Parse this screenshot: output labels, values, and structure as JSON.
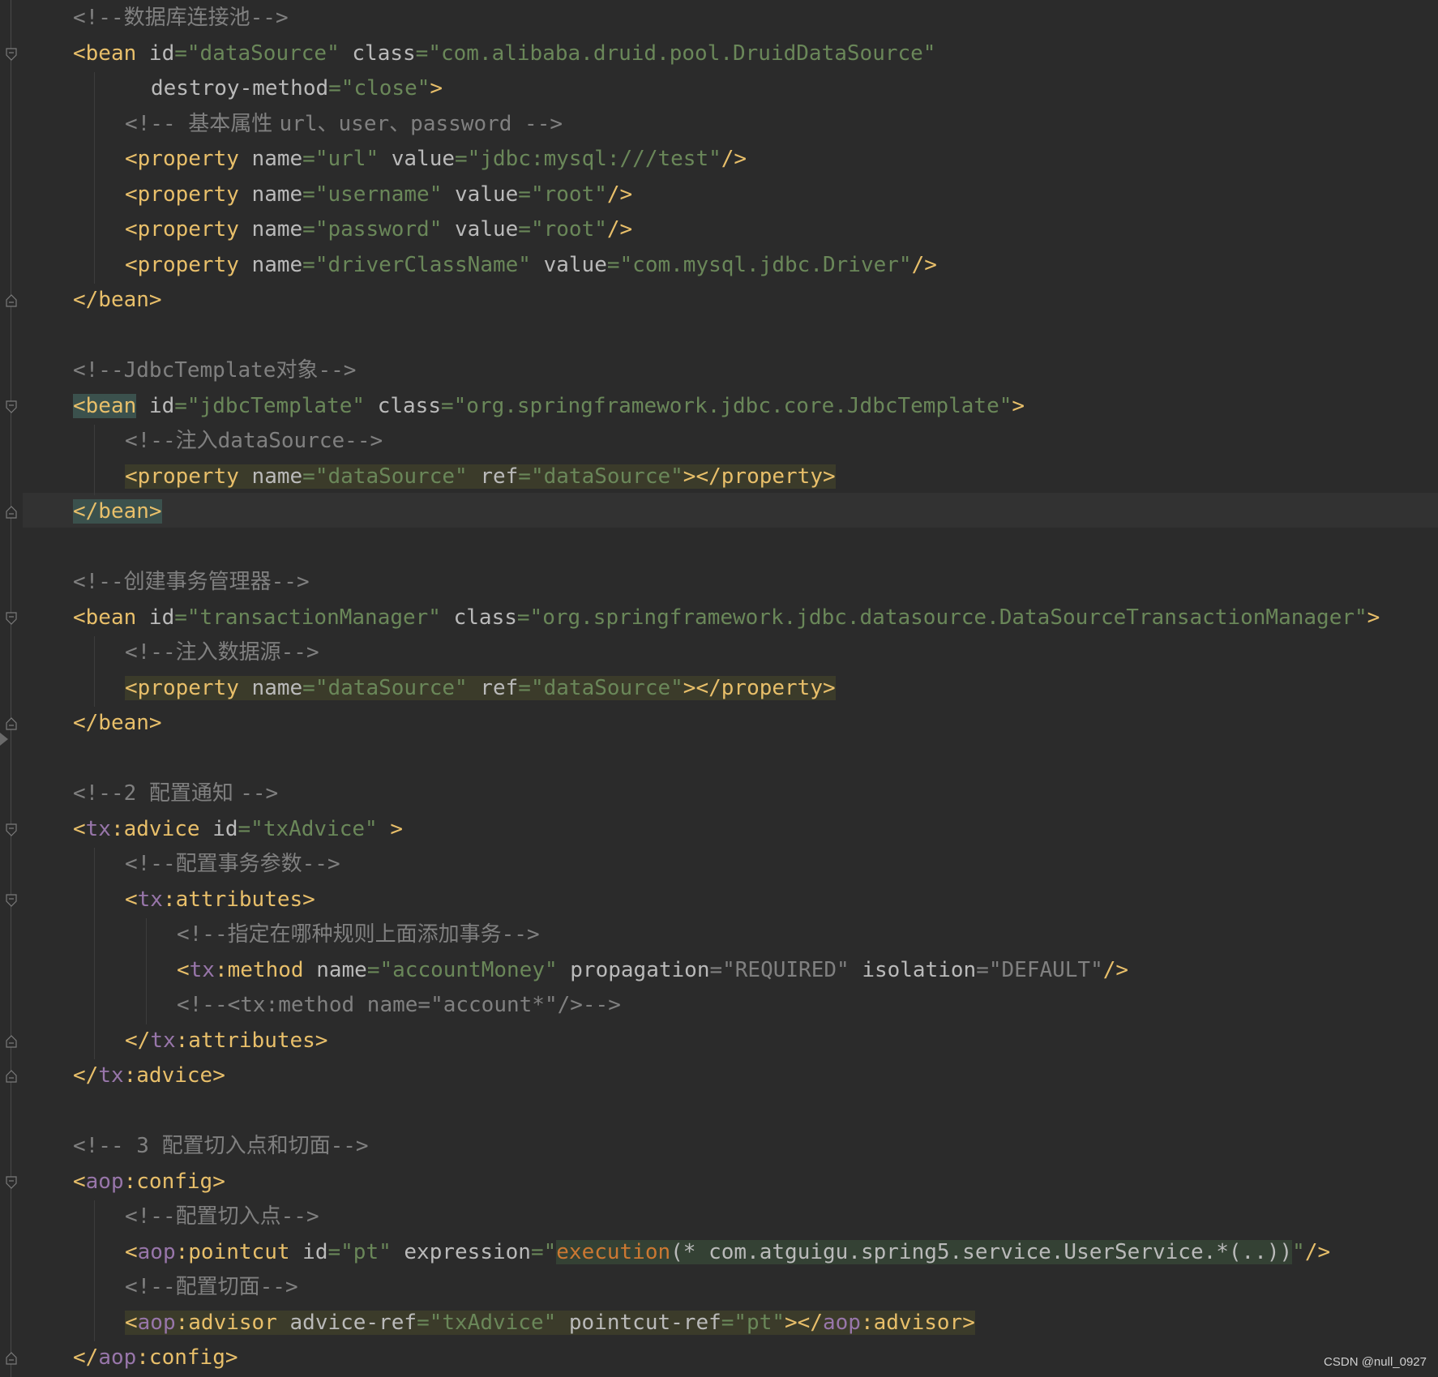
{
  "editor": {
    "lines": [
      {
        "t": 0,
        "indent": 0,
        "tokens": [
          [
            "cm",
            "<!--"
          ],
          [
            "cmc",
            "数据库连接池"
          ],
          [
            "cm",
            "-->"
          ]
        ]
      },
      {
        "t": 1,
        "indent": 0,
        "tokens": [
          [
            "tg",
            "<bean "
          ],
          [
            "at",
            "id"
          ],
          [
            "vl",
            "=\"dataSource\" "
          ],
          [
            "at",
            "class"
          ],
          [
            "vl",
            "=\"com.alibaba.druid.pool.DruidDataSource\""
          ]
        ]
      },
      {
        "t": 2,
        "indent": 3,
        "tokens": [
          [
            "at",
            "destroy-method"
          ],
          [
            "vl",
            "=\"close\""
          ],
          [
            "tg",
            ">"
          ]
        ]
      },
      {
        "t": 3,
        "indent": 2,
        "tokens": [
          [
            "cm",
            "<!-- "
          ],
          [
            "cmc",
            "基本属性 "
          ],
          [
            "cm",
            "url"
          ],
          [
            "cmc",
            "、"
          ],
          [
            "cm",
            "user"
          ],
          [
            "cmc",
            "、"
          ],
          [
            "cm",
            "password -->"
          ]
        ]
      },
      {
        "t": 4,
        "indent": 2,
        "tokens": [
          [
            "tg",
            "<property "
          ],
          [
            "at",
            "name"
          ],
          [
            "vl",
            "=\"url\" "
          ],
          [
            "at",
            "value"
          ],
          [
            "vl",
            "=\"jdbc:mysql:///test\""
          ],
          [
            "tg",
            "/>"
          ]
        ]
      },
      {
        "t": 5,
        "indent": 2,
        "tokens": [
          [
            "tg",
            "<property "
          ],
          [
            "at",
            "name"
          ],
          [
            "vl",
            "=\"username\" "
          ],
          [
            "at",
            "value"
          ],
          [
            "vl",
            "=\"root\""
          ],
          [
            "tg",
            "/>"
          ]
        ]
      },
      {
        "t": 6,
        "indent": 2,
        "tokens": [
          [
            "tg",
            "<property "
          ],
          [
            "at",
            "name"
          ],
          [
            "vl",
            "=\"password\" "
          ],
          [
            "at",
            "value"
          ],
          [
            "vl",
            "=\"root\""
          ],
          [
            "tg",
            "/>"
          ]
        ]
      },
      {
        "t": 7,
        "indent": 2,
        "tokens": [
          [
            "tg",
            "<property "
          ],
          [
            "at",
            "name"
          ],
          [
            "vl",
            "=\"driverClassName\" "
          ],
          [
            "at",
            "value"
          ],
          [
            "vl",
            "=\"com.mysql.jdbc.Driver\""
          ],
          [
            "tg",
            "/>"
          ]
        ]
      },
      {
        "t": 8,
        "indent": 0,
        "tokens": [
          [
            "tg",
            "</bean>"
          ]
        ]
      },
      {
        "t": 10,
        "indent": 0,
        "tokens": [
          [
            "cm",
            "<!--JdbcTemplate"
          ],
          [
            "cmc",
            "对象"
          ],
          [
            "cm",
            "-->"
          ]
        ]
      },
      {
        "t": 11,
        "indent": 0,
        "tokens": [
          [
            "tg hlb",
            "<bean"
          ],
          [
            "tg",
            " "
          ],
          [
            "at",
            "id"
          ],
          [
            "vl",
            "=\"jdbcTemplate\" "
          ],
          [
            "at",
            "class"
          ],
          [
            "vl",
            "=\"org.springframework.jdbc.core.JdbcTemplate\""
          ],
          [
            "tg",
            ">"
          ]
        ]
      },
      {
        "t": 12,
        "indent": 2,
        "tokens": [
          [
            "cm",
            "<!--"
          ],
          [
            "cmc",
            "注入"
          ],
          [
            "cm",
            "dataSource-->"
          ]
        ]
      },
      {
        "t": 13,
        "indent": 2,
        "tokens": [
          [
            "tg hl",
            "<property "
          ],
          [
            "at hl",
            "name"
          ],
          [
            "vl hl",
            "=\"dataSource\" "
          ],
          [
            "at hl",
            "ref"
          ],
          [
            "vl hl",
            "=\"dataSource\""
          ],
          [
            "tg hl",
            "></property>"
          ]
        ]
      },
      {
        "t": 14,
        "indent": 0,
        "tokens": [
          [
            "tg hlb",
            "</bean>"
          ]
        ]
      },
      {
        "t": 16,
        "indent": 0,
        "tokens": [
          [
            "cm",
            "<!--"
          ],
          [
            "cmc",
            "创建事务管理器"
          ],
          [
            "cm",
            "-->"
          ]
        ]
      },
      {
        "t": 17,
        "indent": 0,
        "tokens": [
          [
            "tg",
            "<bean "
          ],
          [
            "at",
            "id"
          ],
          [
            "vl",
            "=\"transactionManager\" "
          ],
          [
            "at",
            "class"
          ],
          [
            "vl",
            "=\"org.springframework.jdbc.datasource.DataSourceTransactionManager\""
          ],
          [
            "tg",
            ">"
          ]
        ]
      },
      {
        "t": 18,
        "indent": 2,
        "tokens": [
          [
            "cm",
            "<!--"
          ],
          [
            "cmc",
            "注入数据源"
          ],
          [
            "cm",
            "-->"
          ]
        ]
      },
      {
        "t": 19,
        "indent": 2,
        "tokens": [
          [
            "tg hl",
            "<property "
          ],
          [
            "at hl",
            "name"
          ],
          [
            "vl hl",
            "=\"dataSource\" "
          ],
          [
            "at hl",
            "ref"
          ],
          [
            "vl hl",
            "=\"dataSource\""
          ],
          [
            "tg hl",
            "></property>"
          ]
        ]
      },
      {
        "t": 20,
        "indent": 0,
        "tokens": [
          [
            "tg",
            "</bean>"
          ]
        ]
      },
      {
        "t": 22,
        "indent": 0,
        "tokens": [
          [
            "cm",
            "<!--2 "
          ],
          [
            "cmc",
            "配置通知 "
          ],
          [
            "cm",
            "-->"
          ]
        ]
      },
      {
        "t": 23,
        "indent": 0,
        "tokens": [
          [
            "tg",
            "<"
          ],
          [
            "ns",
            "tx"
          ],
          [
            "tg",
            ":advice "
          ],
          [
            "at",
            "id"
          ],
          [
            "vl",
            "=\"txAdvice\" "
          ],
          [
            "tg",
            ">"
          ]
        ]
      },
      {
        "t": 24,
        "indent": 2,
        "tokens": [
          [
            "cm",
            "<!--"
          ],
          [
            "cmc",
            "配置事务参数"
          ],
          [
            "cm",
            "-->"
          ]
        ]
      },
      {
        "t": 25,
        "indent": 2,
        "tokens": [
          [
            "tg",
            "<"
          ],
          [
            "ns",
            "tx"
          ],
          [
            "tg",
            ":attributes>"
          ]
        ]
      },
      {
        "t": 26,
        "indent": 4,
        "tokens": [
          [
            "cm",
            "<!--"
          ],
          [
            "cmc",
            "指定在哪种规则上面添加事务"
          ],
          [
            "cm",
            "-->"
          ]
        ]
      },
      {
        "t": 27,
        "indent": 4,
        "tokens": [
          [
            "tg",
            "<"
          ],
          [
            "ns",
            "tx"
          ],
          [
            "tg",
            ":method "
          ],
          [
            "at",
            "name"
          ],
          [
            "vl",
            "=\"accountMoney\" "
          ],
          [
            "at",
            "propagation"
          ],
          [
            "cm",
            "=\"REQUIRED\" "
          ],
          [
            "at",
            "isolation"
          ],
          [
            "cm",
            "=\"DEFAULT\""
          ],
          [
            "tg",
            "/>"
          ]
        ]
      },
      {
        "t": 28,
        "indent": 4,
        "tokens": [
          [
            "cm",
            "<!--<tx:method name=\"account*\"/>-->"
          ]
        ]
      },
      {
        "t": 29,
        "indent": 2,
        "tokens": [
          [
            "tg",
            "</"
          ],
          [
            "ns",
            "tx"
          ],
          [
            "tg",
            ":attributes>"
          ]
        ]
      },
      {
        "t": 30,
        "indent": 0,
        "tokens": [
          [
            "tg",
            "</"
          ],
          [
            "ns",
            "tx"
          ],
          [
            "tg",
            ":advice>"
          ]
        ]
      },
      {
        "t": 32,
        "indent": 0,
        "tokens": [
          [
            "cm",
            "<!-- 3 "
          ],
          [
            "cmc",
            "配置切入点和切面"
          ],
          [
            "cm",
            "-->"
          ]
        ]
      },
      {
        "t": 33,
        "indent": 0,
        "tokens": [
          [
            "tg",
            "<"
          ],
          [
            "ns",
            "aop"
          ],
          [
            "tg",
            ":config>"
          ]
        ]
      },
      {
        "t": 34,
        "indent": 2,
        "tokens": [
          [
            "cm",
            "<!--"
          ],
          [
            "cmc",
            "配置切入点"
          ],
          [
            "cm",
            "-->"
          ]
        ]
      },
      {
        "t": 35,
        "indent": 2,
        "tokens": [
          [
            "tg",
            "<"
          ],
          [
            "ns",
            "aop"
          ],
          [
            "tg",
            ":pointcut "
          ],
          [
            "at",
            "id"
          ],
          [
            "vl",
            "=\"pt\" "
          ],
          [
            "at",
            "expression"
          ],
          [
            "vl",
            "=\""
          ],
          [
            "fn hl2",
            "execution"
          ],
          [
            "at hl2",
            "(* com.atguigu.spring5.service.UserService.*(..))"
          ],
          [
            "vl",
            "\""
          ],
          [
            "tg",
            "/>"
          ]
        ]
      },
      {
        "t": 36,
        "indent": 2,
        "tokens": [
          [
            "cm",
            "<!--"
          ],
          [
            "cmc",
            "配置切面"
          ],
          [
            "cm",
            "-->"
          ]
        ]
      },
      {
        "t": 37,
        "indent": 2,
        "tokens": [
          [
            "tg hl",
            "<"
          ],
          [
            "ns hl",
            "aop"
          ],
          [
            "tg hl",
            ":advisor "
          ],
          [
            "at hl",
            "advice-ref"
          ],
          [
            "vl hl",
            "=\"txAdvice\" "
          ],
          [
            "at hl",
            "pointcut-ref"
          ],
          [
            "vl hl",
            "=\"pt\""
          ],
          [
            "tg hl",
            "></"
          ],
          [
            "ns hl",
            "aop"
          ],
          [
            "tg hl",
            ":advisor>"
          ]
        ]
      },
      {
        "t": 38,
        "indent": 0,
        "tokens": [
          [
            "tg",
            "</"
          ],
          [
            "ns",
            "aop"
          ],
          [
            "tg",
            ":config>"
          ]
        ]
      }
    ]
  },
  "watermark": "CSDN @null_0927"
}
